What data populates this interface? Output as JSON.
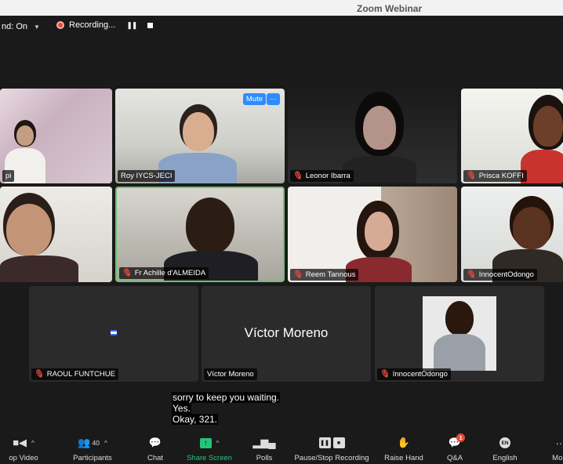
{
  "window": {
    "title": "Zoom Webinar"
  },
  "topbar": {
    "sound_label": "nd: On",
    "recording_label": "Recording...",
    "pause_icon": "pause-icon",
    "stop_icon": "stop-icon"
  },
  "tiles": {
    "t1": {
      "name": "pi"
    },
    "t2": {
      "name": "Roy IYCS-JECI",
      "mute_label": "Mute",
      "more_label": "···"
    },
    "t3": {
      "name": "Leonor Ibarra"
    },
    "t4": {
      "name": "Prisca KOFFI"
    },
    "t6": {
      "name": "Fr Achille d'ALMEIDA"
    },
    "t7": {
      "name": "Reem Tannous"
    },
    "t8": {
      "name": "InnocentOdongo"
    },
    "t9": {
      "name": "RAOUL FUNTCHUE"
    },
    "t10": {
      "name": "Víctor Moreno",
      "center_name": "Víctor Moreno"
    },
    "t11": {
      "name": "InnocentOdongo"
    }
  },
  "captions": [
    "sorry to keep you waiting.",
    "Yes.",
    "Okay, 321."
  ],
  "toolbar": {
    "video_label": "op Video",
    "participants_label": "Participants",
    "participants_count": "40",
    "chat_label": "Chat",
    "share_label": "Share Screen",
    "polls_label": "Polls",
    "recording_label": "Pause/Stop Recording",
    "raise_label": "Raise Hand",
    "qa_label": "Q&A",
    "qa_badge": "1",
    "language_label": "English",
    "language_code": "EN",
    "more_label": "More"
  },
  "colors": {
    "accent": "#2d8cff",
    "share": "#27c37a",
    "muted": "#e8473b",
    "active_speaker": "#6dc16f"
  }
}
